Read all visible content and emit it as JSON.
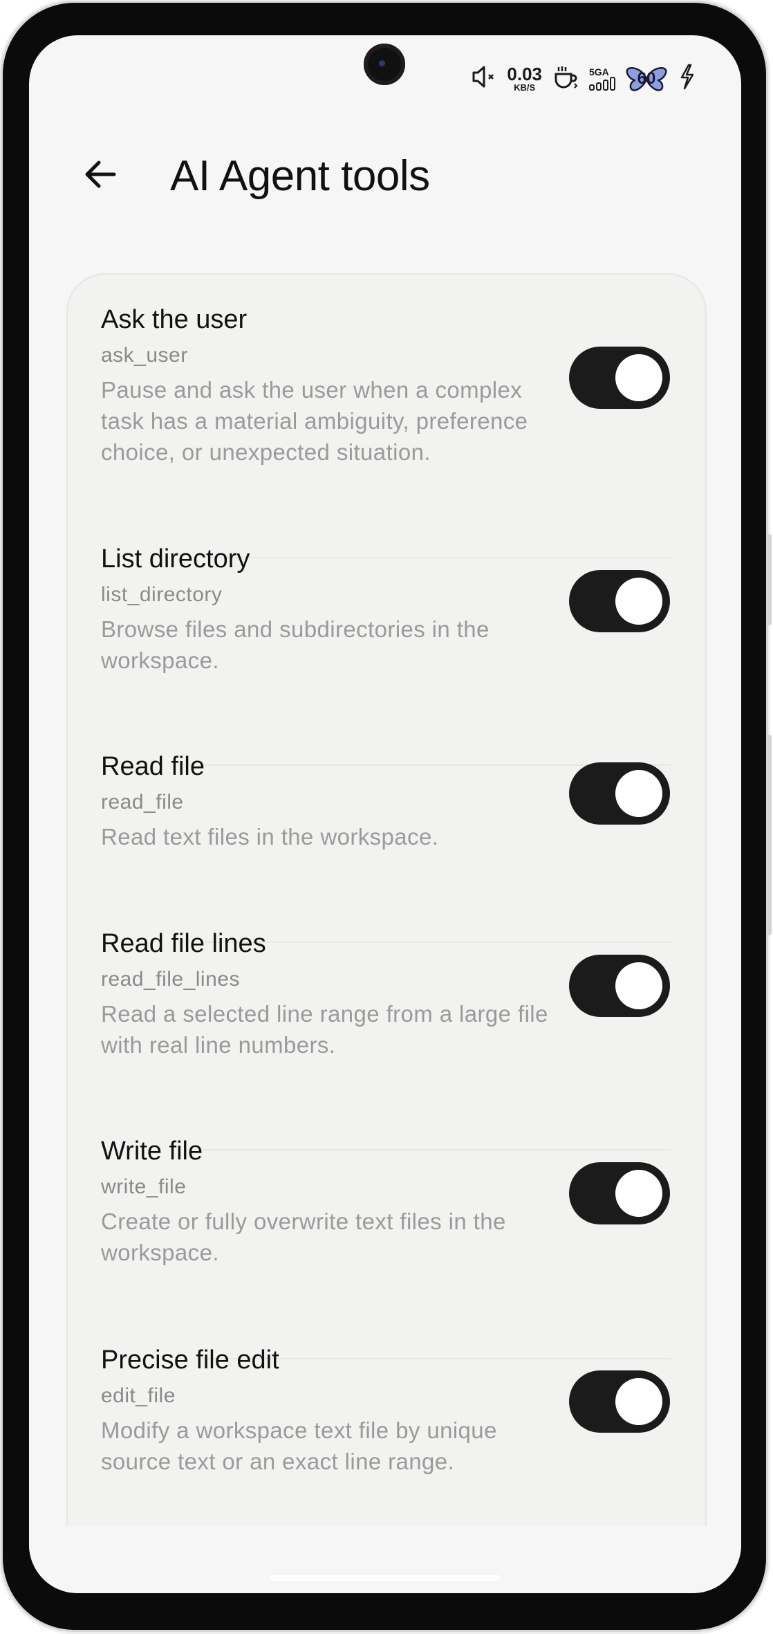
{
  "status_bar": {
    "net_speed_value": "0.03",
    "net_speed_unit": "KB/S",
    "network_label": "5GA",
    "battery_level": "60",
    "icons": [
      "mute-icon",
      "notification-icon",
      "signal-icon",
      "battery-icon",
      "charging-icon"
    ]
  },
  "header": {
    "back_icon": "back-arrow-icon",
    "title": "AI Agent tools"
  },
  "tools": [
    {
      "name": "Ask the user",
      "id": "ask_user",
      "description": "Pause and ask the user when a complex task has a material ambiguity, preference choice, or unexpected situation.",
      "enabled": true
    },
    {
      "name": "List directory",
      "id": "list_directory",
      "description": "Browse files and subdirectories in the workspace.",
      "enabled": true
    },
    {
      "name": "Read file",
      "id": "read_file",
      "description": "Read text files in the workspace.",
      "enabled": true
    },
    {
      "name": "Read file lines",
      "id": "read_file_lines",
      "description": "Read a selected line range from a large file with real line numbers.",
      "enabled": true
    },
    {
      "name": "Write file",
      "id": "write_file",
      "description": "Create or fully overwrite text files in the workspace.",
      "enabled": true
    },
    {
      "name": "Precise file edit",
      "id": "edit_file",
      "description": "Modify a workspace text file by unique source text or an exact line range.",
      "enabled": true
    }
  ],
  "colors": {
    "toggle_on": "#1b1b1b",
    "background": "#f6f6f6",
    "card": "#f2f2f1"
  }
}
